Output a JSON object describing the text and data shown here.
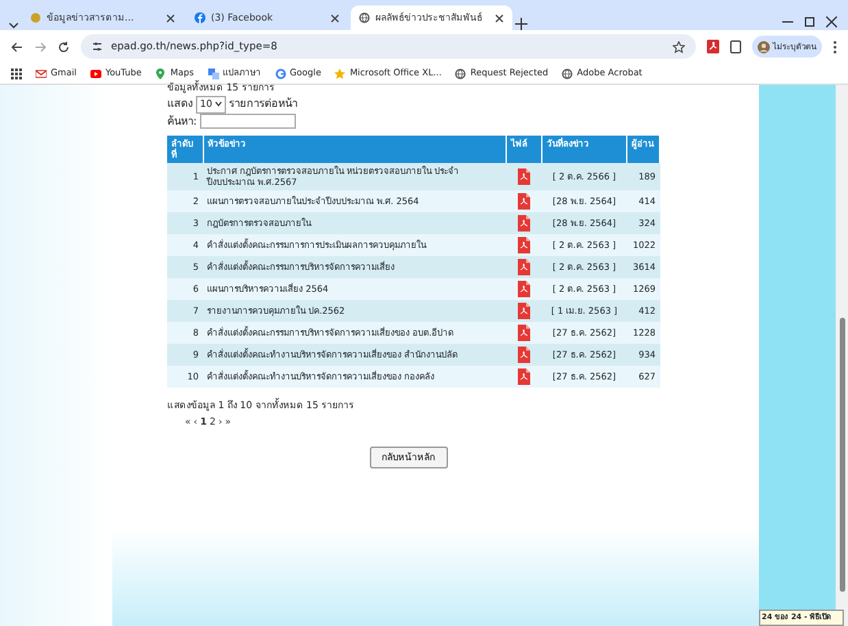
{
  "browser": {
    "tabs": [
      {
        "title": "ข้อมูลข่าวสารตาม...",
        "selected": false
      },
      {
        "title": "(3) Facebook",
        "selected": false
      },
      {
        "title": "ผลลัพธ์ข่าวประชาสัมพันธ์",
        "selected": true
      }
    ],
    "address": "epad.go.th/news.php?id_type=8",
    "profile": "ไม่ระบุตัวตน",
    "bookmarks": [
      {
        "label": "Gmail"
      },
      {
        "label": "YouTube"
      },
      {
        "label": "Maps"
      },
      {
        "label": "แปลภาษา"
      },
      {
        "label": "Google"
      },
      {
        "label": "Microsoft Office XL..."
      },
      {
        "label": "Request Rejected"
      },
      {
        "label": "Adobe Acrobat"
      }
    ]
  },
  "page": {
    "total_note": "ข้อมูลทั้งหมด 15 รายการ",
    "length_label": "แสดง",
    "length_value": "10",
    "length_suffix": "รายการต่อหน้า",
    "search_label": "ค้นหา:",
    "table": {
      "columns": [
        "ลำดับที่",
        "หัวข้อข่าว",
        "ไฟล์",
        "วันที่ลงข่าว",
        "ผู้อ่าน"
      ],
      "rows": [
        {
          "no": "1",
          "title": "ประกาศ กฎบัตรการตรวจสอบภายใน หน่วยตรวจสอบภายใน ประจำปีงบประมาณ พ.ศ.2567",
          "date": "[ 2 ต.ค. 2566 ]",
          "readers": "189"
        },
        {
          "no": "2",
          "title": "แผนการตรวจสอบภายในประจำปีงบประมาณ พ.ศ. 2564",
          "date": "[28 พ.ย. 2564]",
          "readers": "414"
        },
        {
          "no": "3",
          "title": "กฎบัตรการตรวจสอบภายใน",
          "date": "[28 พ.ย. 2564]",
          "readers": "324"
        },
        {
          "no": "4",
          "title": "คำสั่งแต่งตั้งคณะกรรมการการประเมินผลการควบคุมภายใน",
          "date": "[ 2 ต.ค. 2563 ]",
          "readers": "1022"
        },
        {
          "no": "5",
          "title": "คำสั่งแต่งตั้งคณะกรรมการบริหารจัดการความเสี่ยง",
          "date": "[ 2 ต.ค. 2563 ]",
          "readers": "3614"
        },
        {
          "no": "6",
          "title": "แผนการบริหารความเสี่ยง 2564",
          "date": "[ 2 ต.ค. 2563 ]",
          "readers": "1269"
        },
        {
          "no": "7",
          "title": "รายงานการควบคุมภายใน ปค.2562",
          "date": "[ 1 เม.ย. 2563 ]",
          "readers": "412"
        },
        {
          "no": "8",
          "title": "คำสั่งแต่งตั้งคณะกรรมการบริหารจัดการความเสี่ยงของ อบต.อีปาด",
          "date": "[27 ธ.ค. 2562]",
          "readers": "1228"
        },
        {
          "no": "9",
          "title": "คำสั่งแต่งตั้งคณะทำงานบริหารจัดการความเสี่ยงของ สำนักงานปลัด",
          "date": "[27 ธ.ค. 2562]",
          "readers": "934"
        },
        {
          "no": "10",
          "title": "คำสั่งแต่งตั้งคณะทำงานบริหารจัดการความเสี่ยงของ กองคลัง",
          "date": "[27 ธ.ค. 2562]",
          "readers": "627"
        }
      ]
    },
    "info": "แสดงข้อมูล 1 ถึง 10 จากทั้งหมด 15 รายการ",
    "pager": [
      {
        "label": "«",
        "selected": false
      },
      {
        "label": "‹",
        "selected": false
      },
      {
        "label": "1",
        "selected": true
      },
      {
        "label": "2",
        "selected": false
      },
      {
        "label": "›",
        "selected": false
      },
      {
        "label": "»",
        "selected": false
      }
    ],
    "back_button": "กลับหน้าหลัก"
  },
  "notification": {
    "title": "24 ของ 24 - พิธีเปิด"
  }
}
